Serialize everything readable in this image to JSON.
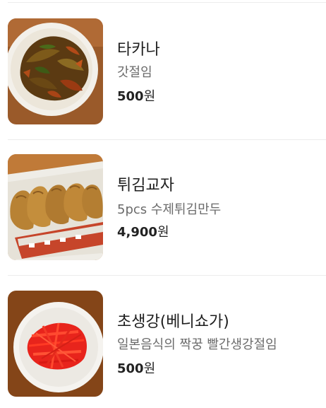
{
  "menu": {
    "items": [
      {
        "name": "타카나",
        "description": "갓절임",
        "price": "500",
        "currency": "원",
        "image_icon": "takana-dish-image"
      },
      {
        "name": "튀김교자",
        "description": "5pcs 수제튀김만두",
        "price": "4,900",
        "currency": "원",
        "image_icon": "fried-gyoza-image"
      },
      {
        "name": "초생강(베니쇼가)",
        "description": "일본음식의 짝꿍 빨간생강절임",
        "price": "500",
        "currency": "원",
        "image_icon": "pickled-ginger-image"
      }
    ]
  }
}
